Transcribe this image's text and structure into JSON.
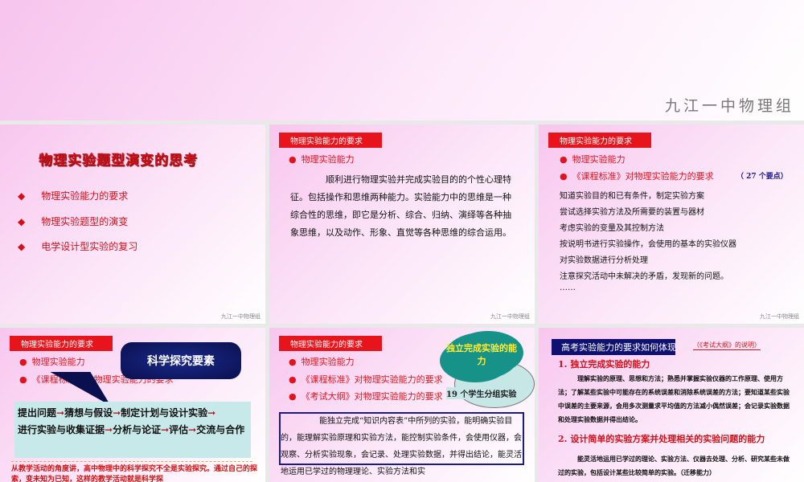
{
  "footer": "九江一中物理组",
  "slide0": {
    "footer": "九江一中物理组"
  },
  "slide1": {
    "title": "物理实验题型演变的思考",
    "items": [
      "物理实验能力的要求",
      "物理实验题型的演变",
      "电学设计型实验的复习"
    ]
  },
  "slide2": {
    "header": "物理实验能力的要求",
    "bullet": "物理实验能力",
    "paragraph": "顺利进行物理实验并完成实验目的的个性心理特征。包括操作和思维两种能力。实验能力中的思维是一种综合性的思维，即它是分析、综合、归纳、演绎等各种抽象思维，以及动作、形象、直觉等各种思维的综合运用。"
  },
  "slide3": {
    "header": "物理实验能力的要求",
    "bullets": [
      "物理实验能力",
      "《课程标准》对物理实验能力的要求"
    ],
    "note": "（ 27 个要点）",
    "items": [
      "知道实验目的和已有条件，制定实验方案",
      "尝试选择实验方法及所需要的装置与器材",
      "考虑实验的变量及其控制方法",
      "按说明书进行实验操作，会使用的基本的实验仪器",
      "对实验数据进行分析处理",
      "注意探究活动中未解决的矛盾，发现新的问题。",
      "……"
    ]
  },
  "slide4": {
    "header": "物理实验能力的要求",
    "bullets": [
      "物理实验能力",
      "《课程标准》对物理实验能力的要求"
    ],
    "callout": "科学探究要素",
    "steps": [
      "提出问题",
      "猜想与假设",
      "制定计划与设计实验",
      "进行实验与收集证据",
      "分析与论证",
      "评估",
      "交流与合作"
    ],
    "arrow": "➞",
    "note": "从教学活动的角度讲，高中物理中的科学探究不全是实验探究。通过自己的探索，变未知为已知，这样的教学活动就是科学探"
  },
  "slide5": {
    "header": "物理实验能力的要求",
    "bullets": [
      "物理实验能力",
      "《课程标准》对物理实验能力的要求",
      "《考试大纲》对物理实验能力的要求"
    ],
    "cloud": "独立完成实验的能力",
    "bubble_text": "19 个学生分组实验",
    "paragraph": "能独立完成“知识内容表”中所列的实验，能明确实验目的，能理解实验原理和实验方法，能控制实验条件，会使用仪器，会观察、分析实验现象，会记录、处理实验数据，并得出结论，能灵活地运用已学过的物理理论、实验方法和实"
  },
  "slide6": {
    "header": "高考实验能力的要求如何体现",
    "source": "（《考试大纲》的说明）",
    "sec1": "1. 独立完成实验的能力",
    "para1": "理解实验的原理、思想和方法；熟悉并掌握实验仪器的工作原理、使用方法；了解某些实验中可能存在的系统误差和消除系统误差的方法；要知道某些实验中误差的主要来源，会用多次测量求平均值的方法减小偶然误差；会记录实验数据和处理实验数据并得出结论。",
    "sec2": "2. 设计简单的实验方案并处理相关的实验问题的能力",
    "para2": "能灵活地运用已学过的理论、实验方法、仪器去处理、分析、研究某些未做过的实验，包括设计某些比较简单的实验。（迁移能力）"
  }
}
